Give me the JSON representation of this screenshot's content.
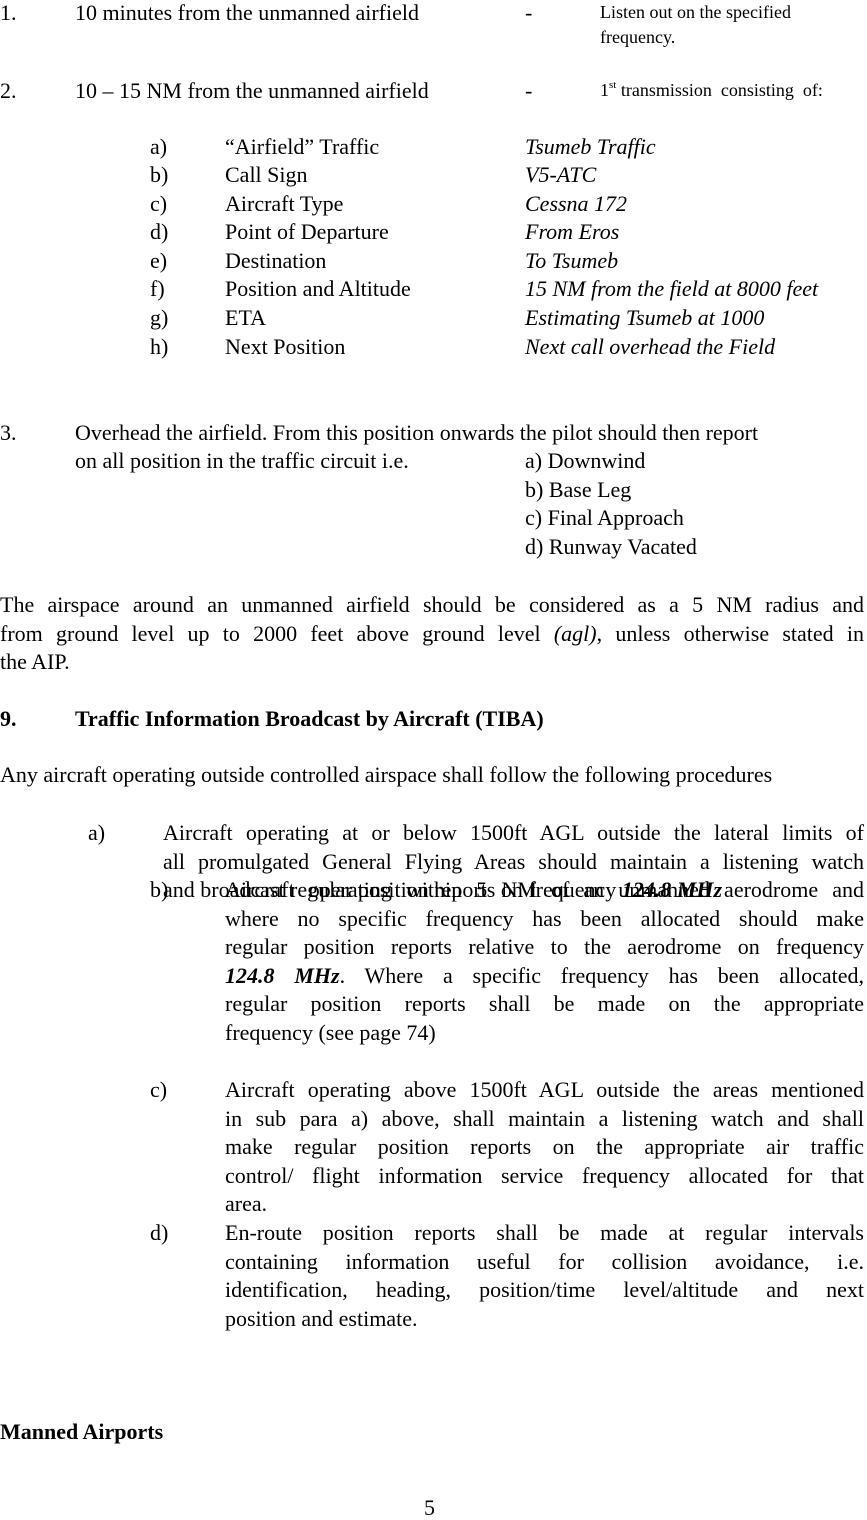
{
  "items": [
    {
      "number": "1.",
      "label": "10 minutes from the unmanned airfield",
      "dash": "-",
      "action_lines": [
        "Listen out on the specified",
        "frequency."
      ]
    },
    {
      "number": "2.",
      "label": "10 – 15 NM from the unmanned airfield",
      "dash": "-",
      "action_prefix": "1",
      "action_sup": "st",
      "action_rest": " transmission  consisting  of:",
      "sub_items": [
        {
          "letter": "a)",
          "field": "“Airfield” Traffic",
          "example": "Tsumeb Traffic"
        },
        {
          "letter": "b)",
          "field": "Call Sign",
          "example": "V5-ATC"
        },
        {
          "letter": "c)",
          "field": "Aircraft Type",
          "example": "Cessna 172"
        },
        {
          "letter": "d)",
          "field": "Point of Departure",
          "example": "From Eros"
        },
        {
          "letter": "e)",
          "field": "Destination",
          "example": "To Tsumeb"
        },
        {
          "letter": "f)",
          "field": "Position and Altitude",
          "example": "15 NM from the field at 8000 feet"
        },
        {
          "letter": "g)",
          "field": "ETA",
          "example": "Estimating Tsumeb at 1000"
        },
        {
          "letter": "h)",
          "field": "Next Position",
          "example": "Next call overhead the Field"
        }
      ]
    },
    {
      "number": "3.",
      "line1": "Overhead the airfield. From this position onwards the pilot should then report",
      "line2": "on all position in the traffic circuit i.e.",
      "positions": [
        "a) Downwind",
        "b) Base Leg",
        "c) Final Approach",
        "d) Runway Vacated"
      ]
    }
  ],
  "airspace_paragraph": {
    "line1": "The airspace around an unmanned airfield should be considered as a 5 NM radius and",
    "line2_before": "from ground level up to 2000 feet above ground level ",
    "line2_italic": "(agl)",
    "line2_after": ", unless otherwise stated in",
    "line3": "the AIP."
  },
  "section9": {
    "number": "9.",
    "title": "Traffic Information Broadcast by Aircraft (TIBA)",
    "intro": "Any aircraft operating outside controlled airspace shall follow the following procedures",
    "procedures": [
      {
        "letter": "a)",
        "lines": [
          "Aircraft operating at or below 1500ft AGL outside the lateral limits of",
          "all promulgated General Flying Areas should maintain a listening watch"
        ],
        "last_before": "and broadcast regular position reports on frequency ",
        "last_bold": "124.8 MHz"
      },
      {
        "letter": "b)",
        "lines": [
          "Aircraft operating within 5 NM of an unmanned aerodrome and",
          "where no specific frequency has been allocated should make",
          "regular position reports relative to the aerodrome on frequency"
        ],
        "line4_bold": "124.8 MHz",
        "line4_rest": ". Where a specific frequency has been allocated,",
        "line5": "regular position reports shall be made on the appropriate",
        "line6": "frequency (see page 74)"
      },
      {
        "letter": "c)",
        "lines": [
          "Aircraft operating above 1500ft AGL outside the areas mentioned",
          "in sub para a) above, shall maintain a listening watch and shall",
          "make regular position reports on the appropriate air traffic",
          "control/ flight information service frequency allocated for that"
        ],
        "last": "area."
      },
      {
        "letter": "d)",
        "lines": [
          "En-route position reports shall be made at regular intervals",
          "containing information useful for collision avoidance, i.e.",
          "identification, heading, position/time level/altitude and next"
        ],
        "last": "position and estimate."
      }
    ]
  },
  "next_heading": "Manned Airports",
  "page_number": "5"
}
